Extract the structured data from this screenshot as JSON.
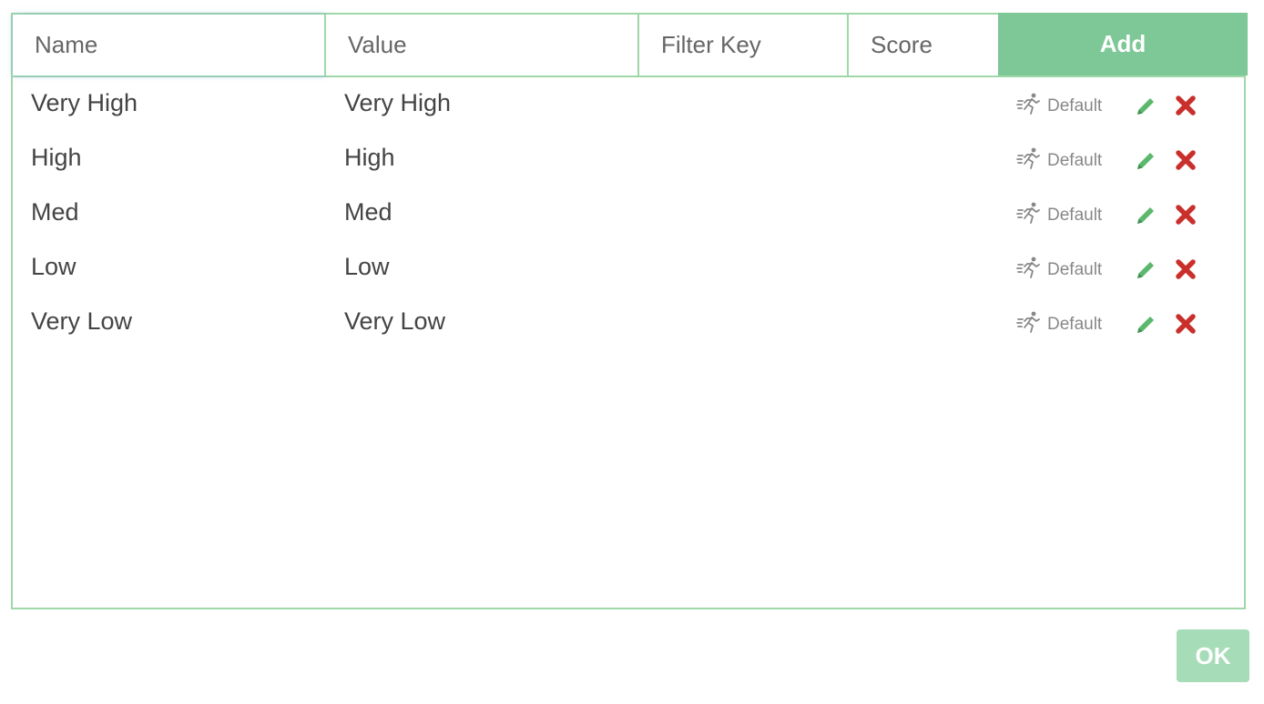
{
  "add_form": {
    "name_placeholder": "Name",
    "value_placeholder": "Value",
    "filter_key_placeholder": "Filter Key",
    "score_placeholder": "Score",
    "add_label": "Add"
  },
  "rows": [
    {
      "name": "Very High",
      "value": "Very High",
      "default_label": "Default",
      "default_icon": "runner-icon",
      "edit_icon": "pencil-icon",
      "delete_icon": "x-icon"
    },
    {
      "name": "High",
      "value": "High",
      "default_label": "Default",
      "default_icon": "runner-icon",
      "edit_icon": "pencil-icon",
      "delete_icon": "x-icon"
    },
    {
      "name": "Med",
      "value": "Med",
      "default_label": "Default",
      "default_icon": "runner-icon",
      "edit_icon": "pencil-icon",
      "delete_icon": "x-icon"
    },
    {
      "name": "Low",
      "value": "Low",
      "default_label": "Default",
      "default_icon": "runner-icon",
      "edit_icon": "pencil-icon",
      "delete_icon": "x-icon"
    },
    {
      "name": "Very Low",
      "value": "Very Low",
      "default_label": "Default",
      "default_icon": "runner-icon",
      "edit_icon": "pencil-icon",
      "delete_icon": "x-icon"
    }
  ],
  "footer": {
    "ok_label": "OK"
  },
  "colors": {
    "border": "#9fd8a8",
    "accent": "#7ec797",
    "ok_button": "#a6dcb7",
    "edit_icon": "#5cb86e",
    "delete_icon": "#c9302c",
    "text": "#444444",
    "muted": "#888888"
  }
}
